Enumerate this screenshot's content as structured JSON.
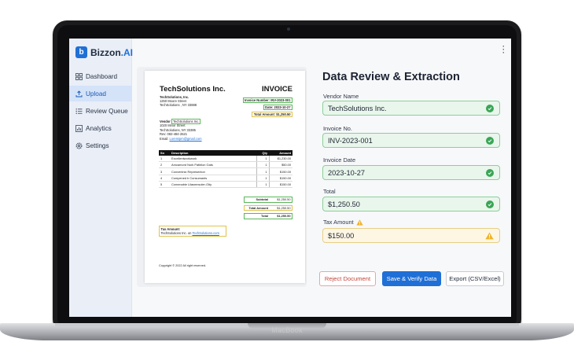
{
  "device": {
    "brand": "MacBook"
  },
  "app": {
    "name_main": "Bizzon",
    "name_suffix": ".AI",
    "logo_letter": "b"
  },
  "sidebar": {
    "items": [
      {
        "label": "Dashboard",
        "icon": "grid-icon",
        "active": false
      },
      {
        "label": "Upload",
        "icon": "upload-icon",
        "active": true
      },
      {
        "label": "Review Queue",
        "icon": "list-icon",
        "active": false
      },
      {
        "label": "Analytics",
        "icon": "chart-icon",
        "active": false
      },
      {
        "label": "Settings",
        "icon": "gear-icon",
        "active": false
      }
    ]
  },
  "invoice": {
    "company": "TechSolutions Inc.",
    "title": "INVOICE",
    "address": [
      "TechSolutions, Inc.",
      "1250 Moore Street",
      "TechSolutions , NY 33888"
    ],
    "invoice_number": "Invoice Number: INV-2023-001",
    "date": "Date: 2023-10-27",
    "total_amount": "Total Amount: $1,250.50",
    "vendor": [
      "Vendor",
      "TechSolutions Inc.",
      "1020 Minor Street",
      "TechSolutions, NY 33385",
      "Rev: 082-484-2621",
      "Email:",
      "Loremipm@gmail.com"
    ],
    "table_headers": [
      "Sn",
      "Description",
      "Qty",
      "Amount"
    ],
    "rows": [
      [
        "1",
        "Excellentworkwork",
        "1",
        "$1,230.00"
      ],
      [
        "2",
        "Amcarnord Nork Patblion Gats",
        "1",
        "$50.00"
      ],
      [
        "3",
        "Conventnic Representon",
        "1",
        "$150.00"
      ],
      [
        "4",
        "Compened b Consumants",
        "1",
        "$150.00"
      ],
      [
        "5",
        "Connmabie Lilasmnsoler-Oity",
        "1",
        "$150.00"
      ]
    ],
    "subtotal": {
      "label": "Subtotal",
      "value": "$1,250.50"
    },
    "total_amount_row": {
      "label": "Total Amount",
      "value": "$1,250.50"
    },
    "total_row": {
      "label": "Total",
      "value": "$1,250.50"
    },
    "tax": [
      "Tax Amount:",
      "TechSolutions Inc. on",
      "TechSolutions.com"
    ],
    "footer": "Copyright © 2022 All right reserved."
  },
  "review": {
    "title": "Data Review & Extraction",
    "fields": [
      {
        "label": "Vendor Name",
        "value": "TechSolutions Inc.",
        "status": "verified"
      },
      {
        "label": "Invoice No.",
        "value": "INV-2023-001",
        "status": "verified"
      },
      {
        "label": "Invoice Date",
        "value": "2023-10-27",
        "status": "verified"
      },
      {
        "label": "Total",
        "value": "$1,250.50",
        "status": "verified"
      },
      {
        "label": "Tax Amount",
        "value": "$150.00",
        "status": "warning"
      }
    ],
    "buttons": {
      "reject": "Reject Document",
      "save": "Save & Verify Data",
      "export": "Export (CSV/Excel)"
    }
  },
  "colors": {
    "accent": "#1f6fd6",
    "success": "#3aa655",
    "warning": "#f0b429",
    "danger": "#c2473c"
  }
}
